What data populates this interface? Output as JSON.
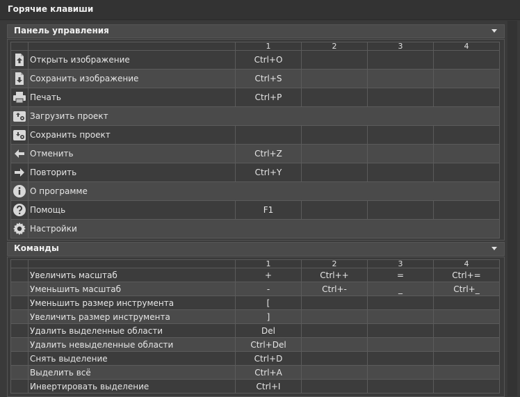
{
  "window": {
    "title": "Горячие клавиши"
  },
  "columns": [
    "1",
    "2",
    "3",
    "4"
  ],
  "panel_control": {
    "title": "Панель управления",
    "rows": [
      {
        "icon": "file-upload-icon",
        "label": "Открыть изображение",
        "keys": [
          "Ctrl+O",
          "",
          "",
          ""
        ]
      },
      {
        "icon": "file-download-icon",
        "label": "Сохранить изображение",
        "keys": [
          "Ctrl+S",
          "",
          "",
          ""
        ]
      },
      {
        "icon": "printer-icon",
        "label": "Печать",
        "keys": [
          "Ctrl+P",
          "",
          "",
          ""
        ]
      },
      {
        "icon": "load-project-icon",
        "label": "Загрузить проект",
        "keys": null
      },
      {
        "icon": "save-project-icon",
        "label": "Сохранить проект",
        "keys": [
          "",
          "",
          "",
          ""
        ]
      },
      {
        "icon": "arrow-left-icon",
        "label": "Отменить",
        "keys": [
          "Ctrl+Z",
          "",
          "",
          ""
        ]
      },
      {
        "icon": "arrow-right-icon",
        "label": "Повторить",
        "keys": [
          "Ctrl+Y",
          "",
          "",
          ""
        ]
      },
      {
        "icon": "info-icon",
        "label": "О программе",
        "keys": null
      },
      {
        "icon": "help-icon",
        "label": "Помощь",
        "keys": [
          "F1",
          "",
          "",
          ""
        ]
      },
      {
        "icon": "gear-icon",
        "label": "Настройки",
        "keys": null
      }
    ]
  },
  "panel_commands": {
    "title": "Команды",
    "rows": [
      {
        "label": "Увеличить масштаб",
        "keys": [
          "+",
          "Ctrl++",
          "=",
          "Ctrl+="
        ]
      },
      {
        "label": "Уменьшить масштаб",
        "keys": [
          "-",
          "Ctrl+-",
          "_",
          "Ctrl+_"
        ]
      },
      {
        "label": "Уменьшить размер инструмента",
        "keys": [
          "[",
          "",
          "",
          ""
        ]
      },
      {
        "label": "Увеличить размер инструмента",
        "keys": [
          "]",
          "",
          "",
          ""
        ]
      },
      {
        "label": "Удалить выделенные области",
        "keys": [
          "Del",
          "",
          "",
          ""
        ]
      },
      {
        "label": "Удалить невыделенные области",
        "keys": [
          "Ctrl+Del",
          "",
          "",
          ""
        ]
      },
      {
        "label": "Снять выделение",
        "keys": [
          "Ctrl+D",
          "",
          "",
          ""
        ]
      },
      {
        "label": "Выделить всё",
        "keys": [
          "Ctrl+A",
          "",
          "",
          ""
        ]
      },
      {
        "label": "Инвертировать выделение",
        "keys": [
          "Ctrl+I",
          "",
          "",
          ""
        ]
      }
    ]
  }
}
